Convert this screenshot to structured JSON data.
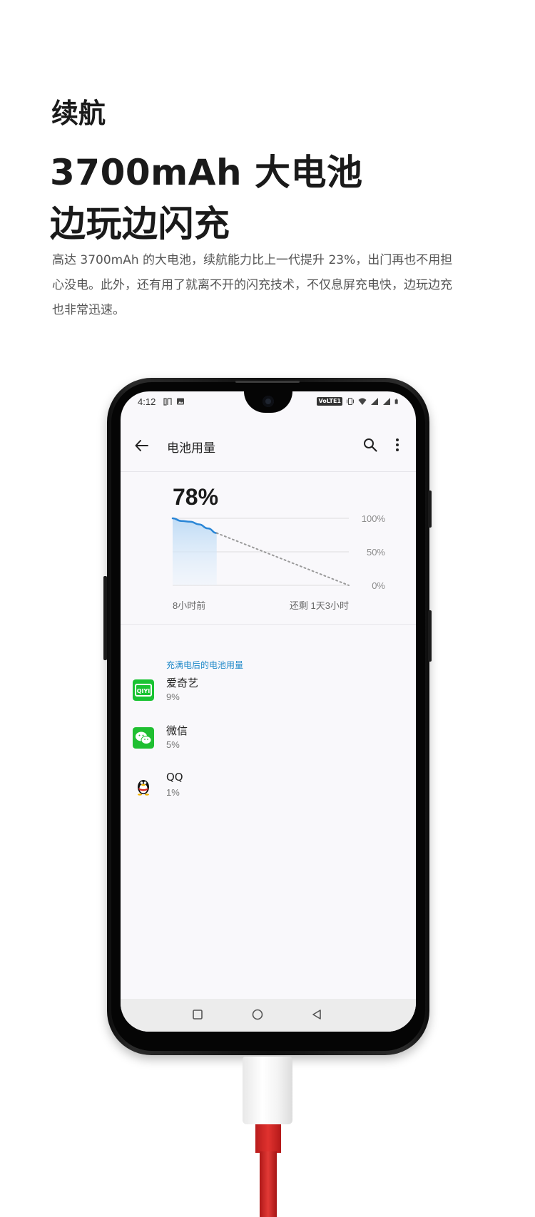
{
  "page": {
    "section_label": "续航",
    "headline_line1": "3700mAh 大电池",
    "headline_line2": "边玩边闪充",
    "description": "高达 3700mAh 的大电池，续航能力比上一代提升 23%，出门再也不用担心没电。此外，还有用了就离不开的闪充技术，不仅息屏充电快，边玩边充也非常迅速。"
  },
  "status_bar": {
    "time": "4:12",
    "left_icons": [
      "notification-icon",
      "image-icon"
    ],
    "right_icons": [
      "volte-badge",
      "vibrate-icon",
      "wifi-icon",
      "signal-icon",
      "signal-icon",
      "battery-icon"
    ],
    "volte_label": "VoLTE1"
  },
  "app_bar": {
    "title": "电池用量",
    "back_icon": "back-arrow-icon",
    "search_icon": "search-icon",
    "more_icon": "more-vert-icon"
  },
  "battery": {
    "level": "78%",
    "x_label_left": "8小时前",
    "x_label_right": "还剩 1天3小时",
    "accent": "#2a86d6"
  },
  "chart_data": {
    "type": "area",
    "title": "",
    "ylim": [
      0,
      100
    ],
    "y_ticks": [
      "100%",
      "50%",
      "0%"
    ],
    "x_labels": [
      "8小时前",
      "还剩 1天3小时"
    ],
    "series": [
      {
        "name": "",
        "style": "solid",
        "x": [
          0,
          0.05,
          0.1,
          0.15,
          0.2,
          0.25
        ],
        "y": [
          100,
          96,
          95,
          91,
          85,
          78
        ]
      },
      {
        "name": "",
        "style": "dotted",
        "x": [
          0.25,
          1.0
        ],
        "y": [
          78,
          0
        ]
      }
    ],
    "grid": true
  },
  "usage": {
    "group_title": "充满电后的电池用量",
    "apps": [
      {
        "name": "爱奇艺",
        "usage": "9%",
        "icon": "iqiyi-icon",
        "color": "#19c332"
      },
      {
        "name": "微信",
        "usage": "5%",
        "icon": "wechat-icon",
        "color": "#1fbf31"
      },
      {
        "name": "QQ",
        "usage": "1%",
        "icon": "qq-icon",
        "color": "#111111"
      }
    ]
  },
  "nav_bar": {
    "buttons": [
      "recents-icon",
      "home-icon",
      "back-triangle-icon"
    ]
  }
}
